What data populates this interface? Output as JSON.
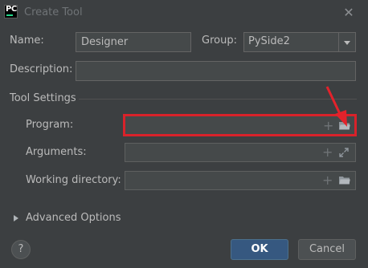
{
  "window": {
    "title": "Create Tool",
    "app_icon_text": "PC",
    "close_icon": "close-icon"
  },
  "form": {
    "name_label": "Name:",
    "name_value": "Designer",
    "group_label": "Group:",
    "group_value": "PySide2",
    "description_label": "Description:",
    "description_value": ""
  },
  "tool_settings": {
    "section_label": "Tool Settings",
    "program_label": "Program:",
    "program_value": "",
    "arguments_label": "Arguments:",
    "arguments_value": "",
    "working_dir_label": "Working directory:",
    "working_dir_value": ""
  },
  "advanced": {
    "label": "Advanced Options",
    "expanded": false
  },
  "footer": {
    "help_label": "?",
    "ok_label": "OK",
    "cancel_label": "Cancel"
  },
  "colors": {
    "background": "#3c3f41",
    "field": "#45494a",
    "accent_ok": "#365880",
    "highlight": "#d9222a"
  },
  "icons": [
    "close-icon",
    "plus-icon",
    "folder-icon",
    "expand-icon",
    "chevron-right-icon",
    "help-icon",
    "dropdown-arrow-icon"
  ]
}
